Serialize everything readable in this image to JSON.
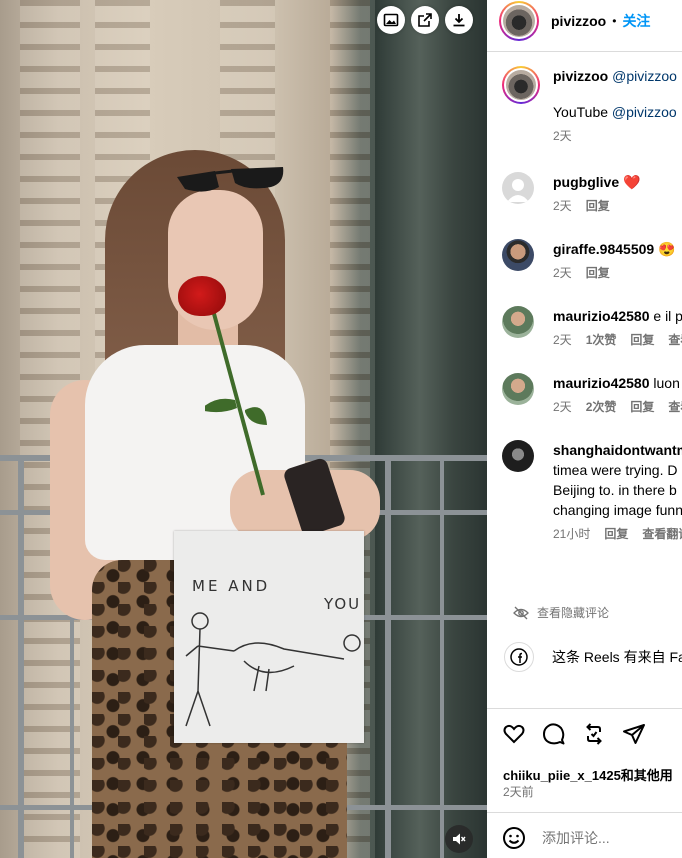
{
  "header": {
    "username": "pivizzoo",
    "separator": "•",
    "follow_label": "关注"
  },
  "media": {
    "toolbar_icons": [
      "image-icon",
      "open-external-icon",
      "download-icon"
    ],
    "mute_icon": "speaker-muted-icon",
    "paper_drawing": {
      "line1": "ME AND",
      "line2": "YOU"
    }
  },
  "caption": {
    "username": "pivizzoo",
    "mention": "@pivizzoo",
    "line2_prefix": "YouTube",
    "line2_mention": "@pivizzoo",
    "time": "2天"
  },
  "comments": [
    {
      "username": "pugbglive",
      "text": "❤️",
      "time": "2天",
      "actions": [
        "回复"
      ]
    },
    {
      "username": "giraffe.9845509",
      "text": "😍",
      "time": "2天",
      "actions": [
        "回复"
      ]
    },
    {
      "username": "maurizio42580",
      "text": "e il p",
      "time": "2天",
      "actions": [
        "1次赞",
        "回复",
        "查看"
      ]
    },
    {
      "username": "maurizio42580",
      "text": "luon",
      "time": "2天",
      "actions": [
        "2次赞",
        "回复",
        "查看"
      ]
    },
    {
      "username": "shanghaidontwantm",
      "lines": [
        "timea were trying. D",
        "Beijing to. in there b",
        "changing image funn"
      ],
      "time": "21小时",
      "actions": [
        "回复",
        "查看翻译"
      ]
    }
  ],
  "hidden_comments_label": "查看隐藏评论",
  "source_note": "这条 Reels 有来自 Fa",
  "likes_text": "chiiku_piie_x_1425和其他用",
  "posted_time": "2天前",
  "add_comment": {
    "placeholder": "添加评论..."
  },
  "colors": {
    "accent": "#0095f6",
    "link": "#00376b",
    "muted": "#737373",
    "heart": "#e0245e"
  }
}
